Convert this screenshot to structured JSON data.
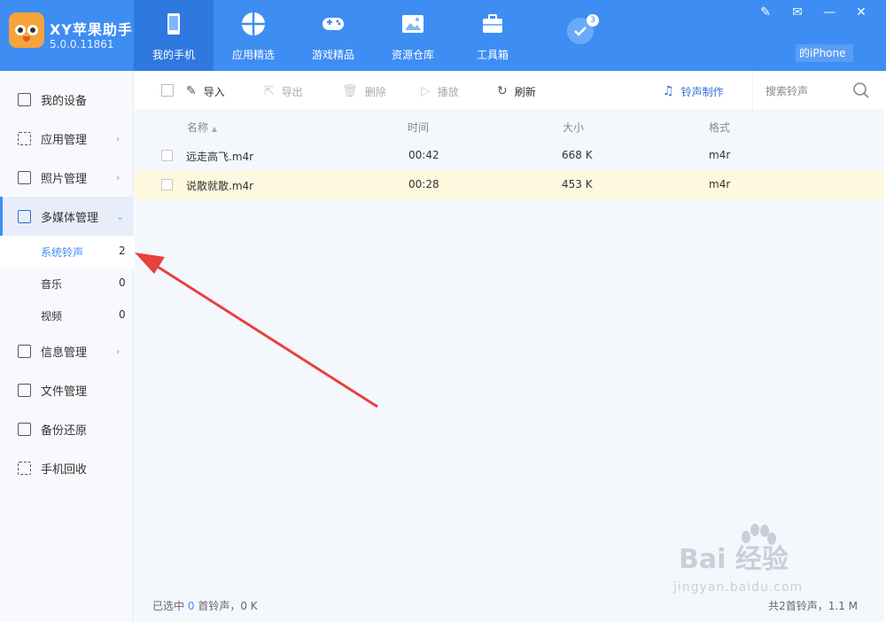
{
  "app": {
    "name": "XY苹果助手",
    "version": "5.0.0.11861"
  },
  "colors": {
    "header": "#3e8df3",
    "active_tab": "#2f78e0",
    "selected_row": "#fdf8de",
    "arrow": "#e8403a"
  },
  "nav": {
    "items": [
      {
        "label": "我的手机",
        "icon": "phone-icon"
      },
      {
        "label": "应用精选",
        "icon": "apps-icon"
      },
      {
        "label": "游戏精品",
        "icon": "gamepad-icon"
      },
      {
        "label": "资源仓库",
        "icon": "image-icon"
      },
      {
        "label": "工具箱",
        "icon": "toolbox-icon"
      }
    ],
    "badge_count": "3"
  },
  "device_label": "的iPhone",
  "sidebar": {
    "items": [
      {
        "label": "我的设备"
      },
      {
        "label": "应用管理"
      },
      {
        "label": "照片管理"
      },
      {
        "label": "多媒体管理"
      },
      {
        "label": "信息管理"
      },
      {
        "label": "文件管理"
      },
      {
        "label": "备份还原"
      },
      {
        "label": "手机回收"
      }
    ],
    "sub_items": [
      {
        "label": "系统铃声",
        "count": "2"
      },
      {
        "label": "音乐",
        "count": "0"
      },
      {
        "label": "视频",
        "count": "0"
      }
    ]
  },
  "toolbar": {
    "import": "导入",
    "export": "导出",
    "delete": "删除",
    "play": "播放",
    "refresh": "刷新",
    "ringtone_maker": "铃声制作",
    "search_placeholder": "搜索铃声"
  },
  "table": {
    "headers": {
      "name": "名称",
      "time": "时间",
      "size": "大小",
      "format": "格式"
    },
    "rows": [
      {
        "name": "远走高飞.m4r",
        "time": "00:42",
        "size": "668 K",
        "format": "m4r"
      },
      {
        "name": "说散就散.m4r",
        "time": "00:28",
        "size": "453 K",
        "format": "m4r"
      }
    ]
  },
  "status": {
    "prefix": "已选中",
    "selected": "0",
    "suffix": "首铃声，0 K",
    "total": "共2首铃声，1.1 M"
  },
  "watermark": {
    "main": "Bai 经验",
    "sub": "jingyan.baidu.com"
  }
}
